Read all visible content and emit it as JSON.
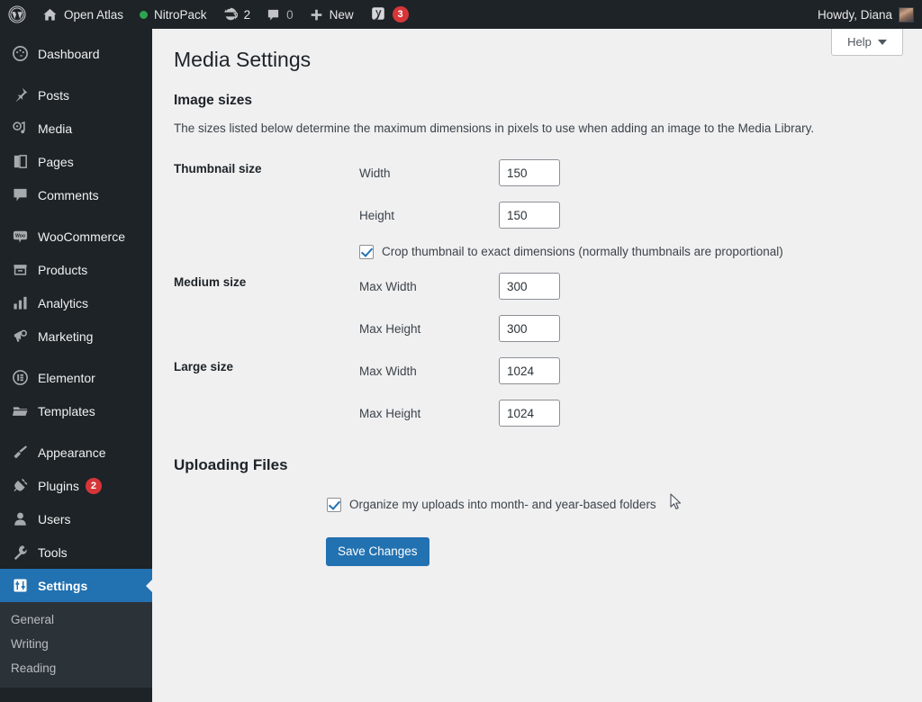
{
  "adminbar": {
    "wp_logo_icon": "wordpress-logo-icon",
    "site_home_icon": "home-icon",
    "site_name": "Open Atlas",
    "nitropack_status_icon": "green-status-dot-icon",
    "nitropack_label": "NitroPack",
    "updates_icon": "updates-icon",
    "updates_count": "2",
    "comments_icon": "comment-bubble-icon",
    "comments_count": "0",
    "new_icon": "plus-icon",
    "new_label": "New",
    "yoast_icon": "yoast-seo-icon",
    "yoast_badge": "3",
    "howdy": "Howdy, Diana",
    "avatar_icon": "user-avatar-icon"
  },
  "sidebar": {
    "items": [
      {
        "label": "Dashboard",
        "icon": "dashboard-icon",
        "badge": null,
        "current": false,
        "gap_before": false
      },
      {
        "label": "Posts",
        "icon": "pin-icon",
        "badge": null,
        "current": false,
        "gap_before": true
      },
      {
        "label": "Media",
        "icon": "media-icon",
        "badge": null,
        "current": false,
        "gap_before": false
      },
      {
        "label": "Pages",
        "icon": "pages-icon",
        "badge": null,
        "current": false,
        "gap_before": false
      },
      {
        "label": "Comments",
        "icon": "comment-bubble-icon",
        "badge": null,
        "current": false,
        "gap_before": false
      },
      {
        "label": "WooCommerce",
        "icon": "woocommerce-icon",
        "badge": null,
        "current": false,
        "gap_before": true
      },
      {
        "label": "Products",
        "icon": "products-box-icon",
        "badge": null,
        "current": false,
        "gap_before": false
      },
      {
        "label": "Analytics",
        "icon": "bar-chart-icon",
        "badge": null,
        "current": false,
        "gap_before": false
      },
      {
        "label": "Marketing",
        "icon": "megaphone-icon",
        "badge": null,
        "current": false,
        "gap_before": false
      },
      {
        "label": "Elementor",
        "icon": "elementor-icon",
        "badge": null,
        "current": false,
        "gap_before": true
      },
      {
        "label": "Templates",
        "icon": "folder-icon",
        "badge": null,
        "current": false,
        "gap_before": false
      },
      {
        "label": "Appearance",
        "icon": "paintbrush-icon",
        "badge": null,
        "current": false,
        "gap_before": true
      },
      {
        "label": "Plugins",
        "icon": "plug-icon",
        "badge": "2",
        "current": false,
        "gap_before": false
      },
      {
        "label": "Users",
        "icon": "user-icon",
        "badge": null,
        "current": false,
        "gap_before": false
      },
      {
        "label": "Tools",
        "icon": "wrench-icon",
        "badge": null,
        "current": false,
        "gap_before": false
      },
      {
        "label": "Settings",
        "icon": "settings-sliders-icon",
        "badge": null,
        "current": true,
        "gap_before": false
      }
    ],
    "submenu": [
      {
        "label": "General"
      },
      {
        "label": "Writing"
      },
      {
        "label": "Reading"
      }
    ]
  },
  "content": {
    "help_label": "Help",
    "help_icon": "chevron-down-icon",
    "page_title": "Media Settings",
    "image_sizes_heading": "Image sizes",
    "image_sizes_description": "The sizes listed below determine the maximum dimensions in pixels to use when adding an image to the Media Library.",
    "rows": [
      {
        "title": "Thumbnail size",
        "fields": [
          {
            "label": "Width",
            "value": "150"
          },
          {
            "label": "Height",
            "value": "150"
          }
        ],
        "checkbox": {
          "label": "Crop thumbnail to exact dimensions (normally thumbnails are proportional)",
          "checked": true
        }
      },
      {
        "title": "Medium size",
        "fields": [
          {
            "label": "Max Width",
            "value": "300"
          },
          {
            "label": "Max Height",
            "value": "300"
          }
        ],
        "checkbox": null
      },
      {
        "title": "Large size",
        "fields": [
          {
            "label": "Max Width",
            "value": "1024"
          },
          {
            "label": "Max Height",
            "value": "1024"
          }
        ],
        "checkbox": null
      }
    ],
    "uploading_files_heading": "Uploading Files",
    "uploads_checkbox_label": "Organize my uploads into month- and year-based folders",
    "uploads_checkbox_checked": true,
    "save_label": "Save Changes"
  },
  "colors": {
    "adminbar_bg": "#1d2327",
    "sidebar_bg": "#1d2327",
    "accent_blue": "#2271b1",
    "badge_red": "#d63638",
    "status_green": "#2ea44f",
    "content_bg": "#f0f0f1"
  }
}
